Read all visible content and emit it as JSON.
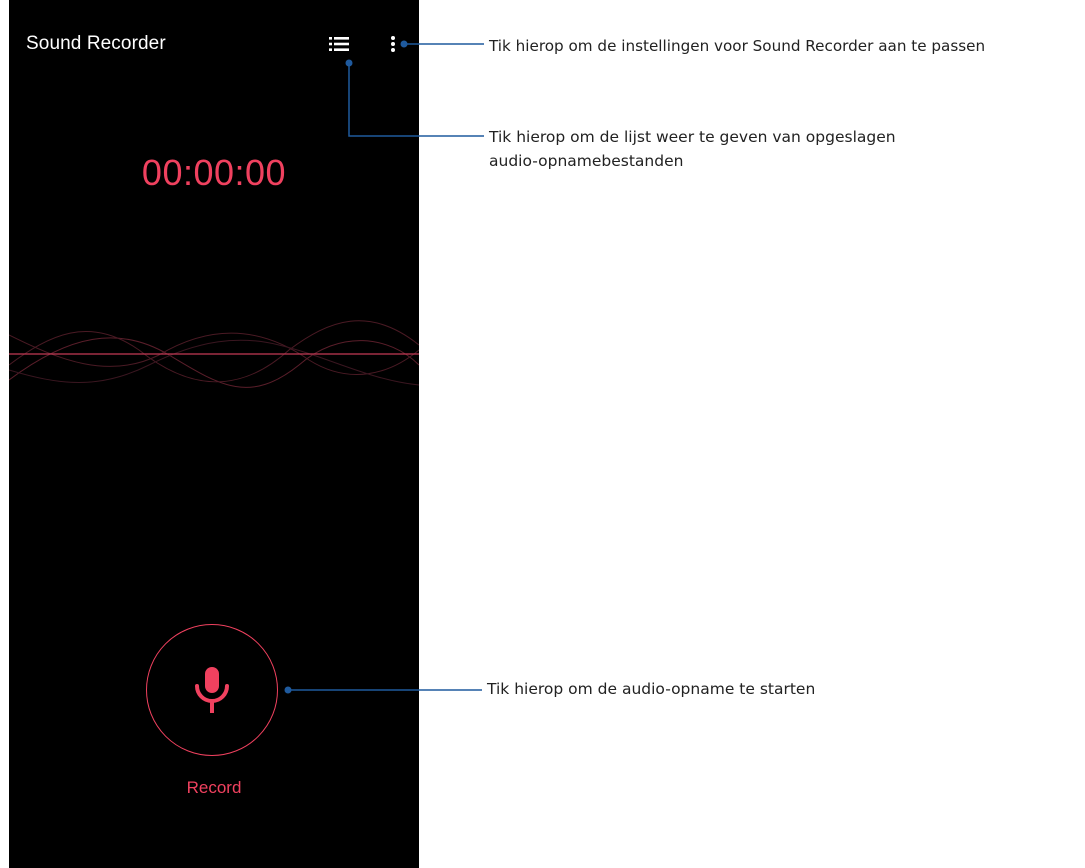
{
  "app": {
    "title": "Sound Recorder",
    "timer": "00:00:00",
    "record_label": "Record"
  },
  "icons": {
    "list": "list-icon",
    "more": "more-vertical-icon",
    "mic": "microphone-icon"
  },
  "colors": {
    "background": "#000000",
    "accent": "#f0415f",
    "annotation_line": "#1f5a9e",
    "annotation_text": "#222222"
  },
  "annotations": {
    "settings": "Tik hierop om de instellingen voor Sound Recorder aan te passen",
    "list_line1": "Tik hierop om de lijst weer te geven van opgeslagen",
    "list_line2": "audio-opnamebestanden",
    "record": "Tik hierop om de audio-opname te starten"
  }
}
